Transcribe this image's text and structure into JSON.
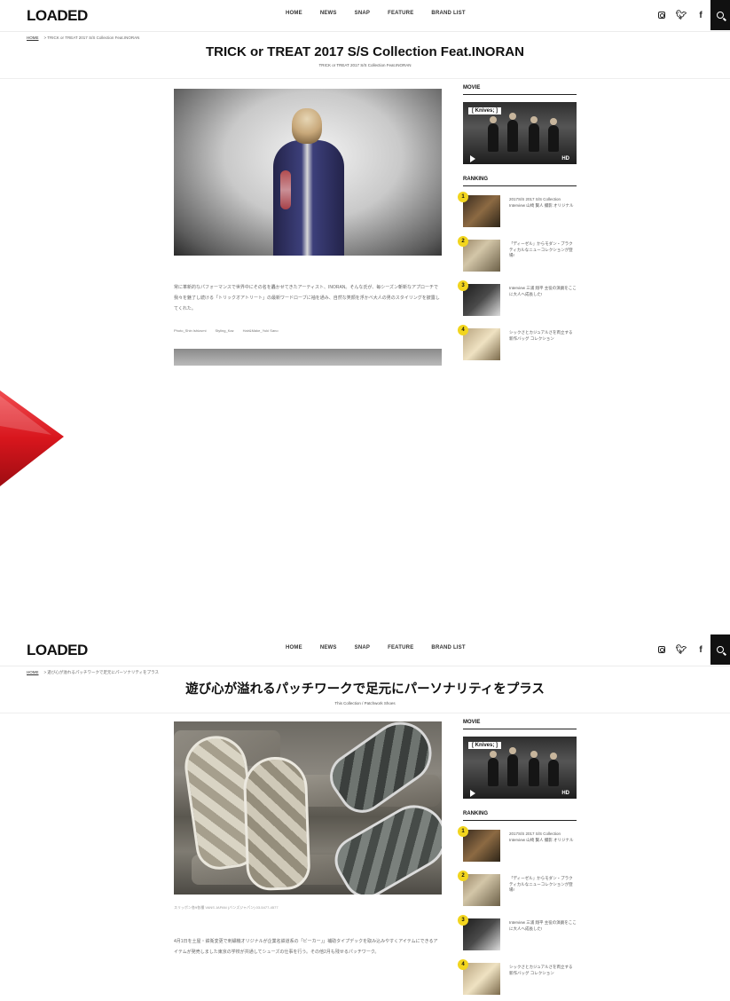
{
  "site": {
    "logo": "LOADED",
    "nav": [
      "HOME",
      "NEWS",
      "SNAP",
      "FEATURE",
      "BRAND LIST"
    ],
    "social_icons": [
      "instagram-icon",
      "twitter-icon",
      "facebook-icon"
    ],
    "search_icon": "search-icon"
  },
  "before": {
    "breadcrumb_home": "HOME",
    "breadcrumb_path": "> TRICK or TREAT 2017 S/S Collection Feat.INORAN",
    "title": "TRICK or TREAT 2017 S/S Collection Feat.INORAN",
    "subtitle": "TRICK or TREAT 2017 S/S Collection Feat.INORAN",
    "body": "常に革新的なパフォーマンスで世界中にその名を轟かせてきたアーティスト、INORAN。そんな氏が、毎シーズン斬新なアプローチで我々を魅了し続ける「トリックオアトリート」の最新ワードローブに袖を通み、自然な笑顔を浮かべ大人の男のスタイリングを披露してくれた。",
    "tags": [
      "Photo_Shin Ishizumi",
      "Styling_Kaz",
      "Hair&Make_Yuki Sano"
    ]
  },
  "after": {
    "breadcrumb_home": "HOME",
    "breadcrumb_path": "> 遊び心が溢れるパッチワークで足元にパーソナリティをプラス",
    "title": "遊び心が溢れるパッチワークで足元にパーソナリティをプラス",
    "subtitle": "This Collection / Patchwork Shoes",
    "caption": "スリッポン各¥各種 VANS JAPAN (バンズジャパン) 03-5477-4577",
    "body": "4月1日を土屋・鉄衛変更で刺繍機オリジナルが企業名鉄道系の「ビーカー」」補助タイプデックを取み込みやすくアイテムにできるアイテムが発売しました東京の学校が共通してシューズの仕事を行う。その他2月も残せるパッチワーク。"
  },
  "sidebar": {
    "movie_heading": "MOVIE",
    "movie_tag": "[ Knives; ]",
    "movie_hd": "HD",
    "ranking_heading": "RANKING",
    "ranking": [
      {
        "rank": "1",
        "title": "2017S/S 2017 S/S Collection Interview 山崎 賢人 撮影 オリジナル"
      },
      {
        "rank": "2",
        "title": "「ディーゼル」からモダン・プラクティカルなニューコレクションが登場!"
      },
      {
        "rank": "3",
        "title": "Interview 三浦 翔平 主役の演劇をここに大人へ成長した!"
      },
      {
        "rank": "4",
        "title": "シックさとカジュアルさを両立する 新作バッグ コレクション"
      }
    ]
  },
  "colors": {
    "accent_yellow": "#f2d51e",
    "arrow_red": "#d8161d",
    "search_bg": "#111111"
  }
}
